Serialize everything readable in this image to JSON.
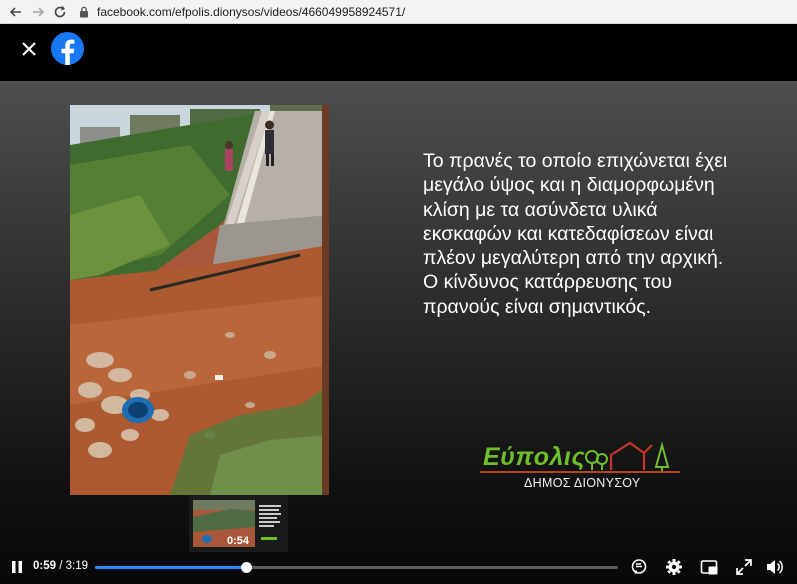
{
  "browser": {
    "url": "facebook.com/efpolis.dionysos/videos/466049958924571/"
  },
  "slide": {
    "text": "Το πρανές το οποίο επιχώνεται έχει μεγάλο ύψος και η διαμορφωμένη κλίση με τα ασύνδετα υλικά εκσκαφών και κατεδαφίσεων είναι πλέον μεγαλύτερη από την αρχική. Ο κίνδυνος κατάρρευσης του πρανούς είναι σημαντικός.",
    "logo_word": "Εύπολις",
    "logo_sub": "ΔΗΜΟΣ ΔΙΟΝΥΣΟΥ"
  },
  "player": {
    "current_time": "0:59",
    "separator": " / ",
    "duration": "3:19",
    "progress_fraction": 0.29,
    "preview_time": "0:54"
  },
  "colors": {
    "accent": "#2d88ff",
    "facebook_blue": "#1877f2",
    "logo_green": "#6fbf2d",
    "logo_red": "#b4441c"
  },
  "icons": {
    "back": "arrow-left-icon",
    "forward": "arrow-right-icon",
    "reload": "reload-icon",
    "lock": "lock-icon",
    "close": "close-icon",
    "facebook": "facebook-logo-icon",
    "pause": "pause-icon",
    "captions": "captions-icon",
    "settings": "gear-icon",
    "pip": "picture-in-picture-icon",
    "fullscreen": "fullscreen-icon",
    "volume": "volume-icon"
  }
}
